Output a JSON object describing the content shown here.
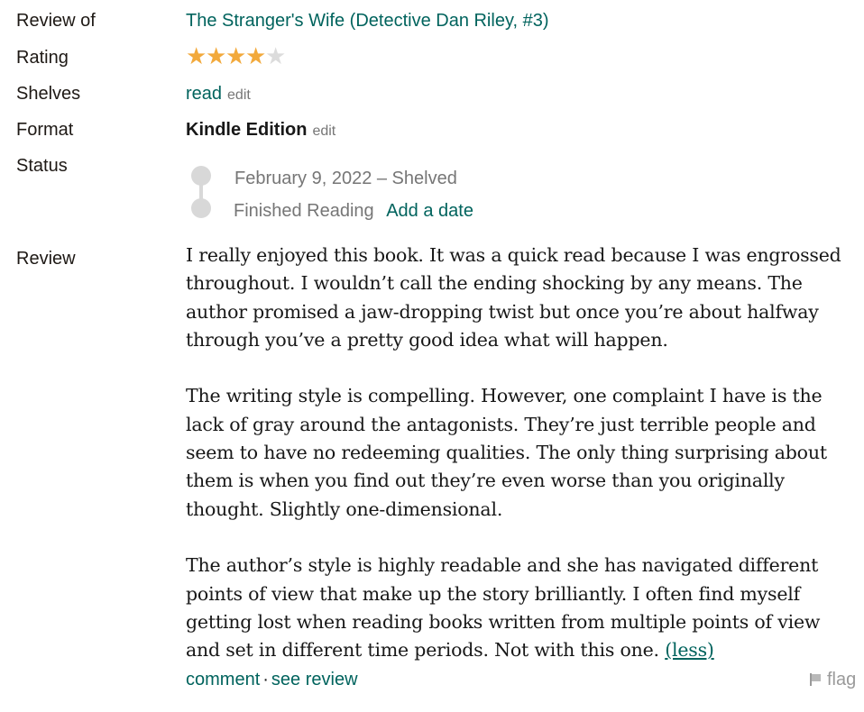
{
  "labels": {
    "review_of": "Review of",
    "rating": "Rating",
    "shelves": "Shelves",
    "format": "Format",
    "status": "Status",
    "review": "Review"
  },
  "book": {
    "title": "The Stranger's Wife (Detective Dan Riley, #3)"
  },
  "rating": {
    "value": 4,
    "max": 5,
    "star_color": "#f2a93b",
    "empty_color": "#dcdcdc"
  },
  "shelves": {
    "shelf": "read",
    "edit_label": "edit"
  },
  "format": {
    "value": "Kindle Edition",
    "edit_label": "edit"
  },
  "status": {
    "shelved_text": "February 9, 2022 – Shelved",
    "finished_label": "Finished Reading",
    "add_date_label": "Add a date"
  },
  "review": {
    "paragraphs": [
      "I really enjoyed this book. It was a quick read because I was engrossed throughout. I wouldn’t call the ending shocking by any means. The author promised a jaw-dropping twist but once you’re about halfway through you’ve a pretty good idea what will happen.",
      "The writing style is compelling. However, one complaint I have is the lack of gray around the antagonists. They’re just terrible people and seem to have no redeeming qualities. The only thing surprising about them is when you find out they’re even worse than you originally thought. Slightly one-dimensional.",
      "The author’s style is highly readable and she has navigated different points of view that make up the story brilliantly. I often find myself getting lost when reading books written from multiple points of view and set in different time periods. Not with this one."
    ],
    "less_label": "(less)"
  },
  "footer": {
    "comment_label": "comment",
    "separator": "·",
    "see_review_label": "see review",
    "flag_label": "flag",
    "flag_icon": "flag-icon"
  },
  "colors": {
    "link": "#00635d",
    "muted": "#767676",
    "dot": "#d8d8d8"
  }
}
